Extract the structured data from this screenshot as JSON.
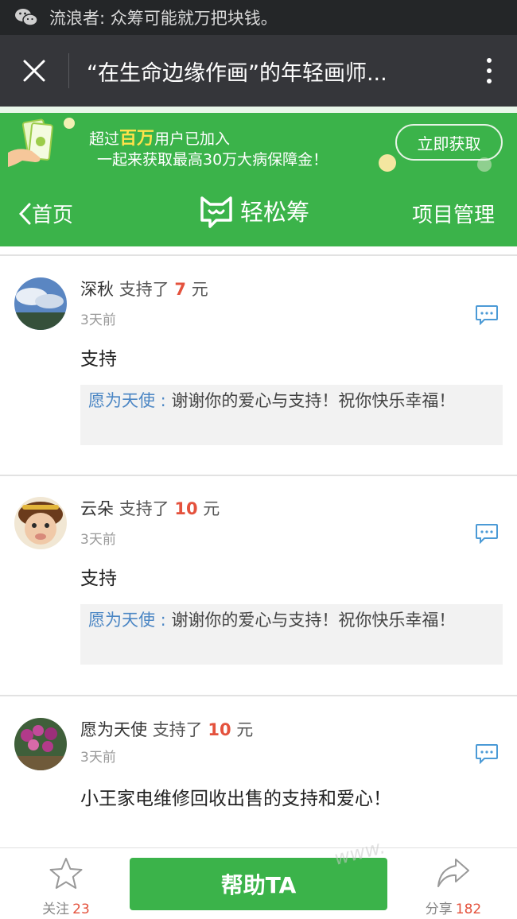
{
  "notification": {
    "app_icon": "wechat-icon",
    "text": "流浪者: 众筹可能就万把块钱。"
  },
  "titlebar": {
    "title": "“在生命边缘作画”的年轻画师...",
    "close_icon": "close-icon",
    "more_icon": "more-vertical-icon"
  },
  "banner": {
    "line1_pre": "超过",
    "line1_highlight": "百万",
    "line1_post": "用户已加入",
    "line2": "一起来获取最高30万大病保障金！",
    "cta": "立即获取",
    "highlight_color": "#ffe24a"
  },
  "nav": {
    "back_label": "首页",
    "brand": "轻松筹",
    "manage_label": "项目管理",
    "accent": "#3bb34a"
  },
  "comments": [
    {
      "user": "深秋",
      "action": "支持了",
      "amount": "7",
      "unit": "元",
      "time": "3天前",
      "message": "支持",
      "reply_who": "愿为天使",
      "reply_sep": " : ",
      "reply_text": "谢谢你的爱心与支持！祝你快乐幸福！"
    },
    {
      "user": "云朵",
      "action": "支持了",
      "amount": "10",
      "unit": "元",
      "time": "3天前",
      "message": "支持",
      "reply_who": "愿为天使",
      "reply_sep": " : ",
      "reply_text": "谢谢你的爱心与支持！祝你快乐幸福！"
    },
    {
      "user": "愿为天使",
      "action": "支持了",
      "amount": "10",
      "unit": "元",
      "time": "3天前",
      "message": "小王家电维修回收出售的支持和爱心！"
    }
  ],
  "bottombar": {
    "follow_label": "关注",
    "follow_count": "23",
    "help_label": "帮助TA",
    "share_label": "分享",
    "share_count": "182"
  },
  "watermark": "www."
}
